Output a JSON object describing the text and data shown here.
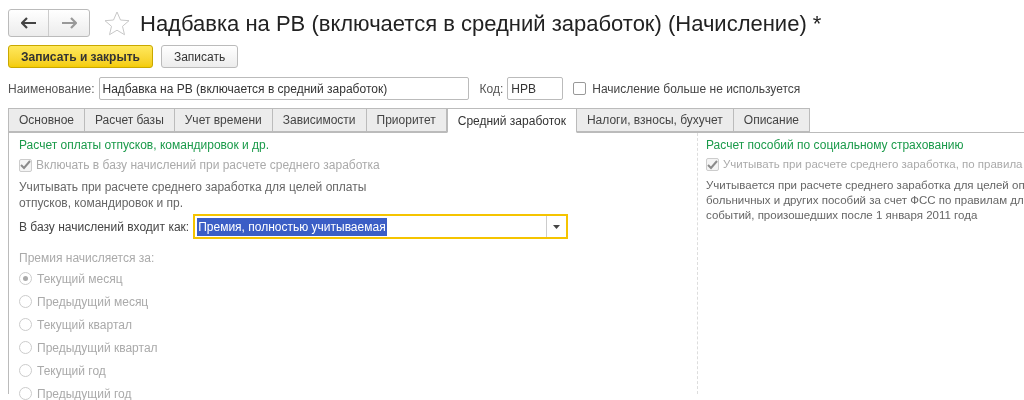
{
  "title": "Надбавка на РВ (включается в средний заработок) (Начисление) *",
  "favorite": false,
  "buttons": [
    {
      "label": "Записать и закрыть",
      "kind": "primary"
    },
    {
      "label": "Записать",
      "kind": "default"
    }
  ],
  "name_field": {
    "label": "Наименование:",
    "value": "Надбавка на РВ (включается в средний заработок)"
  },
  "code_field": {
    "label": "Код:",
    "value": "НРВ"
  },
  "unused_checkbox": {
    "label": "Начисление больше не используется",
    "checked": false
  },
  "tabs": [
    {
      "label": "Основное",
      "selected": false
    },
    {
      "label": "Расчет базы",
      "selected": false
    },
    {
      "label": "Учет времени",
      "selected": false
    },
    {
      "label": "Зависимости",
      "selected": false
    },
    {
      "label": "Приоритет",
      "selected": false
    },
    {
      "label": "Средний заработок",
      "selected": true
    },
    {
      "label": "Налоги, взносы, бухучет",
      "selected": false
    },
    {
      "label": "Описание",
      "selected": false
    }
  ],
  "left_section": {
    "heading": "Расчет оплаты отпусков, командировок и др.",
    "checkbox": {
      "label": "Включать в базу начислений при расчете среднего заработка",
      "checked": true,
      "disabled": true
    },
    "description": [
      "Учитывать при расчете среднего заработка для целей оплаты",
      "отпусков, командировок и пр."
    ],
    "base_select": {
      "label": "В базу начислений входит как:",
      "value": "Премия, полностью учитываемая"
    },
    "period_label": "Премия начисляется за:",
    "periods": [
      {
        "label": "Текущий месяц",
        "selected": true
      },
      {
        "label": "Предыдущий месяц",
        "selected": false
      },
      {
        "label": "Текущий квартал",
        "selected": false
      },
      {
        "label": "Предыдущий квартал",
        "selected": false
      },
      {
        "label": "Текущий год",
        "selected": false
      },
      {
        "label": "Предыдущий год",
        "selected": false
      }
    ]
  },
  "right_section": {
    "heading": "Расчет пособий по социальному страхованию",
    "checkbox": {
      "label": "Учитывать при расчете среднего заработка, по правила",
      "checked": true,
      "disabled": true
    },
    "description": [
      "Учитывается при расчете среднего заработка для целей оп",
      "больничных и других пособий за счет ФСС по правилам дл",
      "событий, произошедших после 1 января 2011 года"
    ]
  }
}
